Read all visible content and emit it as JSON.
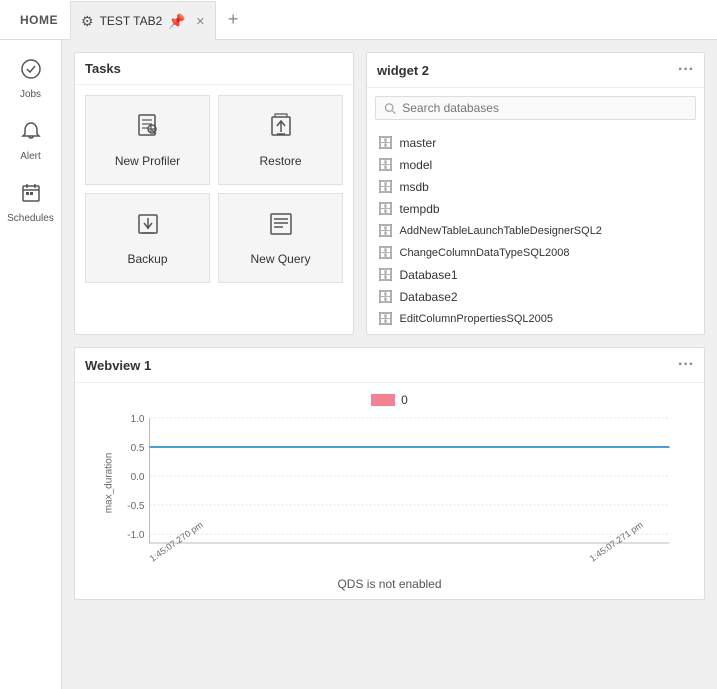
{
  "topbar": {
    "home_label": "HOME",
    "tab_name": "TEST TAB2",
    "add_tab_icon": "+",
    "close_icon": "✕"
  },
  "sidebar": {
    "items": [
      {
        "id": "jobs",
        "label": "Jobs",
        "icon": "⬡"
      },
      {
        "id": "alert",
        "label": "Alert",
        "icon": "🔔"
      },
      {
        "id": "schedules",
        "label": "Schedules",
        "icon": "📅"
      }
    ]
  },
  "tasks_panel": {
    "title": "Tasks",
    "tiles": [
      {
        "id": "new-profiler",
        "label": "New Profiler",
        "icon": "📄"
      },
      {
        "id": "restore",
        "label": "Restore",
        "icon": "🔄"
      },
      {
        "id": "backup",
        "label": "Backup",
        "icon": "📤"
      },
      {
        "id": "new-query",
        "label": "New Query",
        "icon": "≡"
      }
    ]
  },
  "widget2_panel": {
    "title": "widget 2",
    "search_placeholder": "Search databases",
    "databases": [
      {
        "name": "master"
      },
      {
        "name": "model"
      },
      {
        "name": "msdb"
      },
      {
        "name": "tempdb"
      },
      {
        "name": "AddNewTableLaunchTableDesignerSQL2"
      },
      {
        "name": "ChangeColumnDataTypeSQL2008"
      },
      {
        "name": "Database1"
      },
      {
        "name": "Database2"
      },
      {
        "name": "EditColumnPropertiesSQL2005"
      }
    ]
  },
  "webview_panel": {
    "title": "Webview 1",
    "legend_value": "0",
    "y_axis_label": "max_duration",
    "y_ticks": [
      "1.0",
      "0.5",
      "0.0",
      "-0.5",
      "-1.0"
    ],
    "x_labels": [
      "1:45:07.270 pm",
      "1:45:07.271 pm"
    ],
    "footer_text": "QDS is not enabled"
  },
  "colors": {
    "blue_line": "#4a9fd4",
    "legend_pink": "#f48098",
    "background": "#f0f0f0",
    "panel_bg": "#ffffff",
    "border": "#dddddd"
  }
}
